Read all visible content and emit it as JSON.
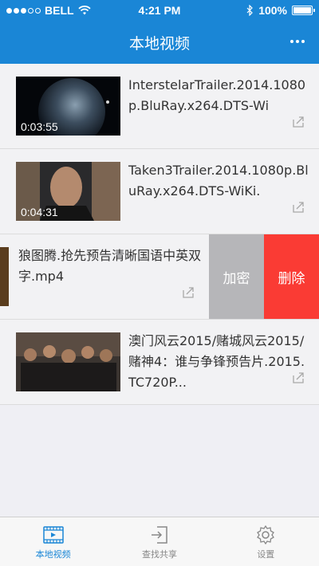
{
  "status_bar": {
    "carrier": "BELL",
    "time": "4:21 PM",
    "battery": "100%"
  },
  "nav": {
    "title": "本地视频"
  },
  "videos": [
    {
      "name": "InterstelarTrailer.2014.1080p.BluRay.x264.DTS-Wi",
      "duration": "0:03:55"
    },
    {
      "name": "Taken3Trailer.2014.1080p.BluRay.x264.DTS-WiKi.",
      "duration": "0:04:31"
    },
    {
      "name": "狼图腾.抢先预告清晰国语中英双字.mp4",
      "duration": ""
    },
    {
      "name": "澳门风云2015/赌城风云2015/赌神4：谁与争锋预告片.2015.TC720P...",
      "duration": ""
    }
  ],
  "swipe_actions": {
    "encrypt": "加密",
    "delete": "删除"
  },
  "tabs": [
    {
      "label": "本地视频",
      "active": true
    },
    {
      "label": "查找共享",
      "active": false
    },
    {
      "label": "设置",
      "active": false
    }
  ],
  "colors": {
    "accent": "#1a86d6",
    "delete": "#fa3b34",
    "encrypt": "#b6b6b9"
  }
}
